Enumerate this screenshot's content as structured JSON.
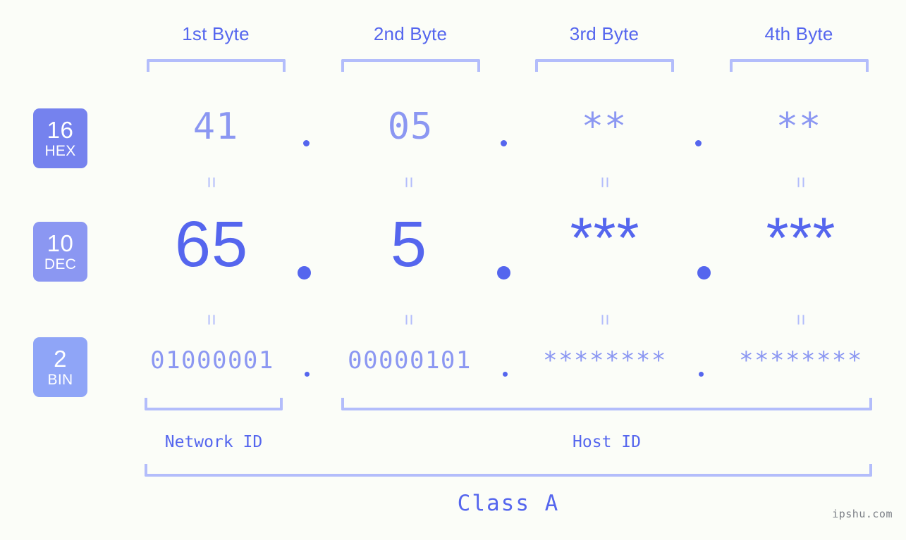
{
  "meta": {
    "watermark": "ipshu.com",
    "accent_dark": "#5566ee",
    "accent_mid": "#8b97f2",
    "accent_light": "#b3bdfb",
    "background": "#fbfdf8"
  },
  "headers": [
    {
      "label": "1st Byte"
    },
    {
      "label": "2nd Byte"
    },
    {
      "label": "3rd Byte"
    },
    {
      "label": "4th Byte"
    }
  ],
  "rows": [
    {
      "badge": {
        "base": "16",
        "name": "HEX"
      },
      "values": [
        "41",
        "05",
        "**",
        "**"
      ],
      "separator": "."
    },
    {
      "badge": {
        "base": "10",
        "name": "DEC"
      },
      "values": [
        "65",
        "5",
        "***",
        "***"
      ],
      "separator": "."
    },
    {
      "badge": {
        "base": "2",
        "name": "BIN"
      },
      "values": [
        "01000001",
        "00000101",
        "********",
        "********"
      ],
      "separator": "."
    }
  ],
  "connectors": {
    "symbol": "=",
    "count_top": 4,
    "count_bottom": 4
  },
  "regions": [
    {
      "label": "Network ID"
    },
    {
      "label": "Host ID"
    }
  ],
  "classification": {
    "label": "Class A"
  }
}
